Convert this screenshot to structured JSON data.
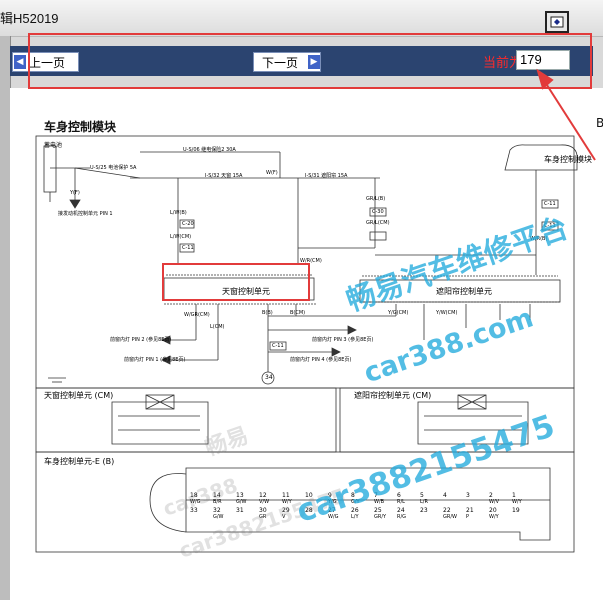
{
  "window": {
    "title": "辑H52019"
  },
  "nav": {
    "prev_label": "上一页",
    "next_label": "下一页",
    "page_label": "当前为",
    "page_value": "179"
  },
  "doc": {
    "title": "车身控制模块",
    "title_right": "B",
    "module_label": "车身控制模块",
    "sunroof_unit": "天窗控制单元",
    "sunshade_unit": "遮阳帘控制单元",
    "conn_sunroof": "天窗控制单元 (CM)",
    "conn_sunshade": "遮阳帘控制单元 (CM)",
    "conn_bcm": "车身控制单元-E (B)",
    "battery": "蓄电池",
    "fuse1": "I-S/32 天窗 15A",
    "fuse2": "I-S/31 遮阳帘 15A",
    "fuse3": "U-S/25 电池保护 5A",
    "fuse4": "U-S/06 继电保险2 30A",
    "lamp1": "前窗内灯 PIN 2 (参见8E页)",
    "lamp2": "前窗内灯 PIN 1 (参见8E页)",
    "lamp3": "前窗内灯 PIN 3 (参见8E页)",
    "lamp4": "前窗内灯 PIN 4 (参见8E页)",
    "ground": "34",
    "bcm_note": "接发动机控制单元 PIN 1",
    "wire_labels": [
      "L/W(B)",
      "L/W(CM)",
      "W/R(CM)",
      "W/R(B)",
      "GR/L(B)",
      "GR/L(CM)",
      "B(CM)",
      "B(B)",
      "W/GR(CM)",
      "L(CM)",
      "Y/G(CM)",
      "Y/W(CM)",
      "Y(F)",
      "W(F)"
    ],
    "connectors": [
      "C-20",
      "C-11",
      "C-30",
      "C-11",
      "C-11",
      "C-11"
    ],
    "pin_row_top": [
      "18",
      "14",
      "13",
      "12",
      "11",
      "10",
      "9",
      "8",
      "7",
      "6",
      "5",
      "4",
      "3",
      "2",
      "1"
    ],
    "pin_row_top_wires": [
      "W/G",
      "B/R",
      "G/W",
      "V/W",
      "W/Y",
      "",
      "Y/G",
      "G/Y",
      "W/B",
      "R/L",
      "L/R",
      "",
      "",
      "W/V",
      "W/Y"
    ],
    "pin_row_bot": [
      "33",
      "32",
      "31",
      "30",
      "29",
      "28",
      "27",
      "26",
      "25",
      "24",
      "23",
      "22",
      "21",
      "20",
      "19"
    ],
    "pin_row_bot_wires": [
      "",
      "G/W",
      "",
      "GR",
      "V",
      "",
      "W/G",
      "L/Y",
      "GR/Y",
      "R/G",
      "",
      "GR/W",
      "P",
      "W/Y",
      ""
    ]
  },
  "watermark": {
    "line1": "畅易汽车维修平台",
    "line2": "car388.com",
    "line3": "car3882155475",
    "ghost1": "畅易",
    "ghost2": "car388",
    "ghost3": "car3882155475"
  }
}
